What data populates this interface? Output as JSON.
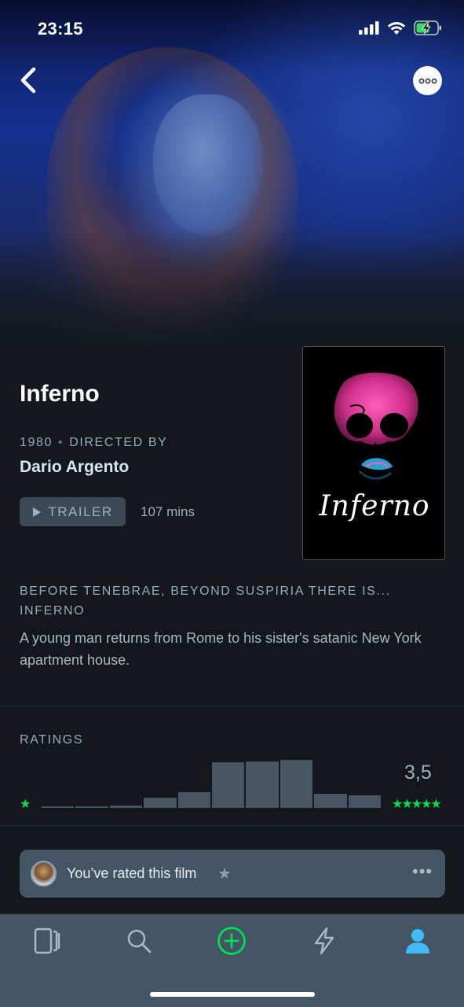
{
  "status_bar": {
    "time": "23:15",
    "icons": [
      "signal-icon",
      "wifi-icon",
      "battery-charging-icon"
    ]
  },
  "nav": {
    "back_icon": "chevron-left-icon",
    "more_icon": "more-dots-icon"
  },
  "film": {
    "title": "Inferno",
    "year": "1980",
    "directed_by_label": "DIRECTED BY",
    "director": "Dario Argento",
    "trailer_label": "TRAILER",
    "runtime": "107 mins",
    "poster_title": "Inferno",
    "tagline": "BEFORE TENEBRAE, BEYOND SUSPIRIA THERE IS... INFERNO",
    "synopsis": "A young man returns from Rome to his sister's satanic New York apartment house."
  },
  "ratings": {
    "label": "RATINGS",
    "average": "3,5",
    "min_stars": "★",
    "max_stars": "★★★★★",
    "histogram_fraction": [
      0.02,
      0.03,
      0.05,
      0.2,
      0.31,
      0.88,
      0.9,
      0.93,
      0.27,
      0.25
    ]
  },
  "rated_banner": {
    "text": "You’ve rated this film",
    "star_icon": "star-outline-icon",
    "more_label": "•••"
  },
  "tabbar": {
    "items": [
      "films-tab",
      "search-tab",
      "add-tab",
      "activity-tab",
      "profile-tab"
    ]
  },
  "colors": {
    "background": "#14181c",
    "panel": "#445566",
    "accent_green": "#00e054",
    "profile_blue": "#40bcf4"
  }
}
